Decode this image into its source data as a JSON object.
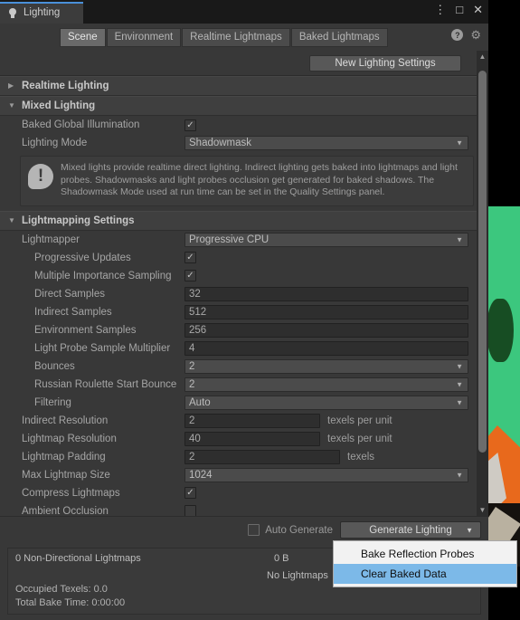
{
  "window": {
    "tab_title": "Lighting",
    "bulb_icon": "light-bulb-icon",
    "controls": {
      "menu": "⋮",
      "maximize": "□",
      "close": "✕"
    },
    "tools": {
      "help": "?",
      "settings": "⚙"
    }
  },
  "tabs": [
    {
      "label": "Scene",
      "active": true
    },
    {
      "label": "Environment",
      "active": false
    },
    {
      "label": "Realtime Lightmaps",
      "active": false
    },
    {
      "label": "Baked Lightmaps",
      "active": false
    }
  ],
  "toolbar": {
    "new_lighting_settings": "New Lighting Settings"
  },
  "sections": {
    "realtime_lighting": {
      "title": "Realtime Lighting",
      "expanded": false,
      "arrow": "▶"
    },
    "mixed_lighting": {
      "title": "Mixed Lighting",
      "expanded": true,
      "arrow": "▼"
    },
    "lightmapping_settings": {
      "title": "Lightmapping Settings",
      "expanded": true,
      "arrow": "▼"
    }
  },
  "mixed_lighting": {
    "baked_gi": {
      "label": "Baked Global Illumination",
      "checked": true,
      "mark": "✓"
    },
    "lighting_mode": {
      "label": "Lighting Mode",
      "value": "Shadowmask"
    },
    "info": "Mixed lights provide realtime direct lighting. Indirect lighting gets baked into lightmaps and light probes. Shadowmasks and light probes occlusion get generated for baked shadows. The Shadowmask Mode used at run time can be set in the Quality Settings panel.",
    "info_icon": "!"
  },
  "lightmapping": {
    "lightmapper": {
      "label": "Lightmapper",
      "value": "Progressive CPU"
    },
    "progressive_updates": {
      "label": "Progressive Updates",
      "checked": true,
      "mark": "✓"
    },
    "multiple_importance_sampling": {
      "label": "Multiple Importance Sampling",
      "checked": true,
      "mark": "✓"
    },
    "direct_samples": {
      "label": "Direct Samples",
      "value": "32"
    },
    "indirect_samples": {
      "label": "Indirect Samples",
      "value": "512"
    },
    "environment_samples": {
      "label": "Environment Samples",
      "value": "256"
    },
    "light_probe_sample_multiplier": {
      "label": "Light Probe Sample Multiplier",
      "value": "4"
    },
    "bounces": {
      "label": "Bounces",
      "value": "2"
    },
    "russian_roulette_start_bounce": {
      "label": "Russian Roulette Start Bounce",
      "value": "2"
    },
    "filtering": {
      "label": "Filtering",
      "value": "Auto"
    },
    "indirect_resolution": {
      "label": "Indirect Resolution",
      "value": "2",
      "suffix": "texels per unit"
    },
    "lightmap_resolution": {
      "label": "Lightmap Resolution",
      "value": "40",
      "suffix": "texels per unit"
    },
    "lightmap_padding": {
      "label": "Lightmap Padding",
      "value": "2",
      "suffix": "texels"
    },
    "max_lightmap_size": {
      "label": "Max Lightmap Size",
      "value": "1024"
    },
    "compress_lightmaps": {
      "label": "Compress Lightmaps",
      "checked": true,
      "mark": "✓"
    },
    "ambient_occlusion": {
      "label": "Ambient Occlusion",
      "checked": false,
      "mark": ""
    }
  },
  "bottom_bar": {
    "auto_generate": {
      "label": "Auto Generate",
      "checked": false
    },
    "generate_lighting": "Generate Lighting",
    "caret": "▼"
  },
  "context_menu": {
    "items": [
      {
        "label": "Bake Reflection Probes",
        "selected": false
      },
      {
        "label": "Clear Baked Data",
        "selected": true
      }
    ]
  },
  "status": {
    "lightmaps_count": "0 Non-Directional Lightmaps",
    "size": "0 B",
    "no_lightmaps": "No Lightmaps",
    "occupied_texels": "Occupied Texels: 0.0",
    "total_bake_time": "Total Bake Time: 0:00:00"
  },
  "scrollbar": {
    "up_arrow": "▲",
    "down_arrow": "▼"
  },
  "colors": {
    "accent_tab": "#4a90d9",
    "panel_bg": "#383838",
    "titlebar_bg": "#191919",
    "menu_highlight": "#7cb9e8",
    "scene_green": "#3cc77e",
    "scene_orange": "#e8691c"
  }
}
